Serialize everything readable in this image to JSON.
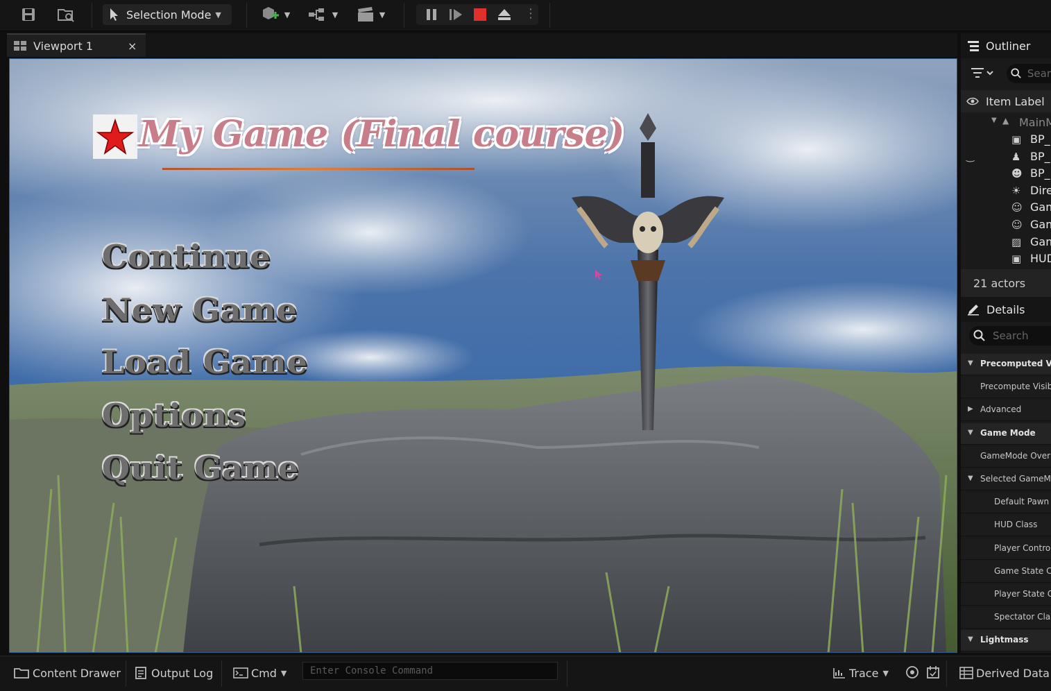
{
  "toolbar": {
    "selection_mode_label": "Selection Mode",
    "icons": [
      "save-icon",
      "content-browser-icon",
      "add-actor-icon",
      "blueprint-icon",
      "cinematics-icon",
      "pause-icon",
      "skip-frame-icon",
      "stop-icon",
      "eject-icon",
      "more-icon"
    ]
  },
  "viewport": {
    "tab_label": "Viewport 1",
    "close_glyph": "×",
    "game_title": "My Game (Final course)",
    "menu": [
      "Continue",
      "New Game",
      "Load Game",
      "Options",
      "Quit Game"
    ]
  },
  "outliner": {
    "title": "Outliner",
    "search_placeholder": "Sear",
    "column_label": "Item Label",
    "root_label": "MainM",
    "items": [
      "BP_",
      "BP_",
      "BP_",
      "Dire",
      "Gam",
      "Gam",
      "Gam",
      "HUD"
    ],
    "actor_count": "21 actors"
  },
  "details": {
    "title": "Details",
    "search_placeholder": "Search",
    "rows": [
      {
        "label": "Precomputed Visi",
        "kind": "section",
        "expanded": true
      },
      {
        "label": "Precompute Visib",
        "kind": "prop",
        "indent": 1
      },
      {
        "label": "Advanced",
        "kind": "section",
        "expanded": false,
        "light": true
      },
      {
        "label": "Game Mode",
        "kind": "section",
        "expanded": true
      },
      {
        "label": "GameMode Overr",
        "kind": "prop",
        "indent": 1
      },
      {
        "label": "Selected GameMo",
        "kind": "section",
        "expanded": true,
        "light": true
      },
      {
        "label": "Default Pawn C",
        "kind": "prop",
        "indent": 2
      },
      {
        "label": "HUD Class",
        "kind": "prop",
        "indent": 2
      },
      {
        "label": "Player Control",
        "kind": "prop",
        "indent": 2
      },
      {
        "label": "Game State Cl",
        "kind": "prop",
        "indent": 2
      },
      {
        "label": "Player State C",
        "kind": "prop",
        "indent": 2
      },
      {
        "label": "Spectator Clas",
        "kind": "prop",
        "indent": 2
      },
      {
        "label": "Lightmass",
        "kind": "section",
        "expanded": true
      }
    ]
  },
  "bottombar": {
    "content_drawer": "Content Drawer",
    "output_log": "Output Log",
    "cmd": "Cmd",
    "console_placeholder": "Enter Console Command",
    "trace": "Trace",
    "derived_data": "Derived Data"
  },
  "colors": {
    "accent_blue": "#2f5a86",
    "stop_red": "#e0302a",
    "title_pink": "#c77d8a"
  }
}
